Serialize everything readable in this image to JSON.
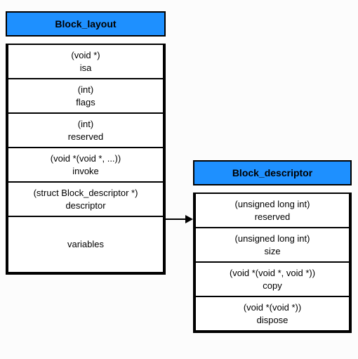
{
  "left": {
    "title": "Block_layout",
    "rows": [
      {
        "type": "(void *)",
        "name": "isa"
      },
      {
        "type": "(int)",
        "name": "flags"
      },
      {
        "type": "(int)",
        "name": "reserved"
      },
      {
        "type": "(void *(void *, ...))",
        "name": "invoke"
      },
      {
        "type": "(struct Block_descriptor *)",
        "name": "descriptor"
      },
      {
        "type": "",
        "name": "variables"
      }
    ]
  },
  "right": {
    "title": "Block_descriptor",
    "rows": [
      {
        "type": "(unsigned long int)",
        "name": "reserved"
      },
      {
        "type": "(unsigned long int)",
        "name": "size"
      },
      {
        "type": "(void *(void *, void *))",
        "name": "copy"
      },
      {
        "type": "(void *(void *))",
        "name": "dispose"
      }
    ]
  }
}
